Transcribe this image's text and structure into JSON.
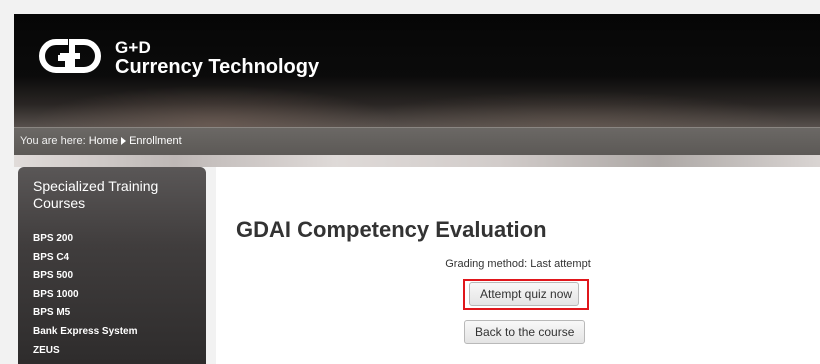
{
  "header": {
    "brand_line1": "G+D",
    "brand_line2": "Currency Technology",
    "logo_icon": "gd-logo-icon"
  },
  "breadcrumb": {
    "prefix": "You are here:",
    "items": [
      "Home",
      "Enrollment"
    ],
    "separator_icon": "triangle-right-icon"
  },
  "sidebar": {
    "title": "Specialized Training Courses",
    "items": [
      {
        "label": "BPS 200"
      },
      {
        "label": "BPS C4"
      },
      {
        "label": "BPS 500"
      },
      {
        "label": "BPS 1000"
      },
      {
        "label": "BPS M5"
      },
      {
        "label": "Bank Express System"
      },
      {
        "label": "ZEUS"
      }
    ]
  },
  "main": {
    "title": "GDAI Competency Evaluation",
    "grading_text": "Grading method: Last attempt",
    "attempt_button": "Attempt quiz now",
    "back_button": "Back to the course"
  },
  "colors": {
    "highlight": "#e0161b",
    "header_bg": "#060606",
    "sidebar_bg": "#403d3d"
  }
}
